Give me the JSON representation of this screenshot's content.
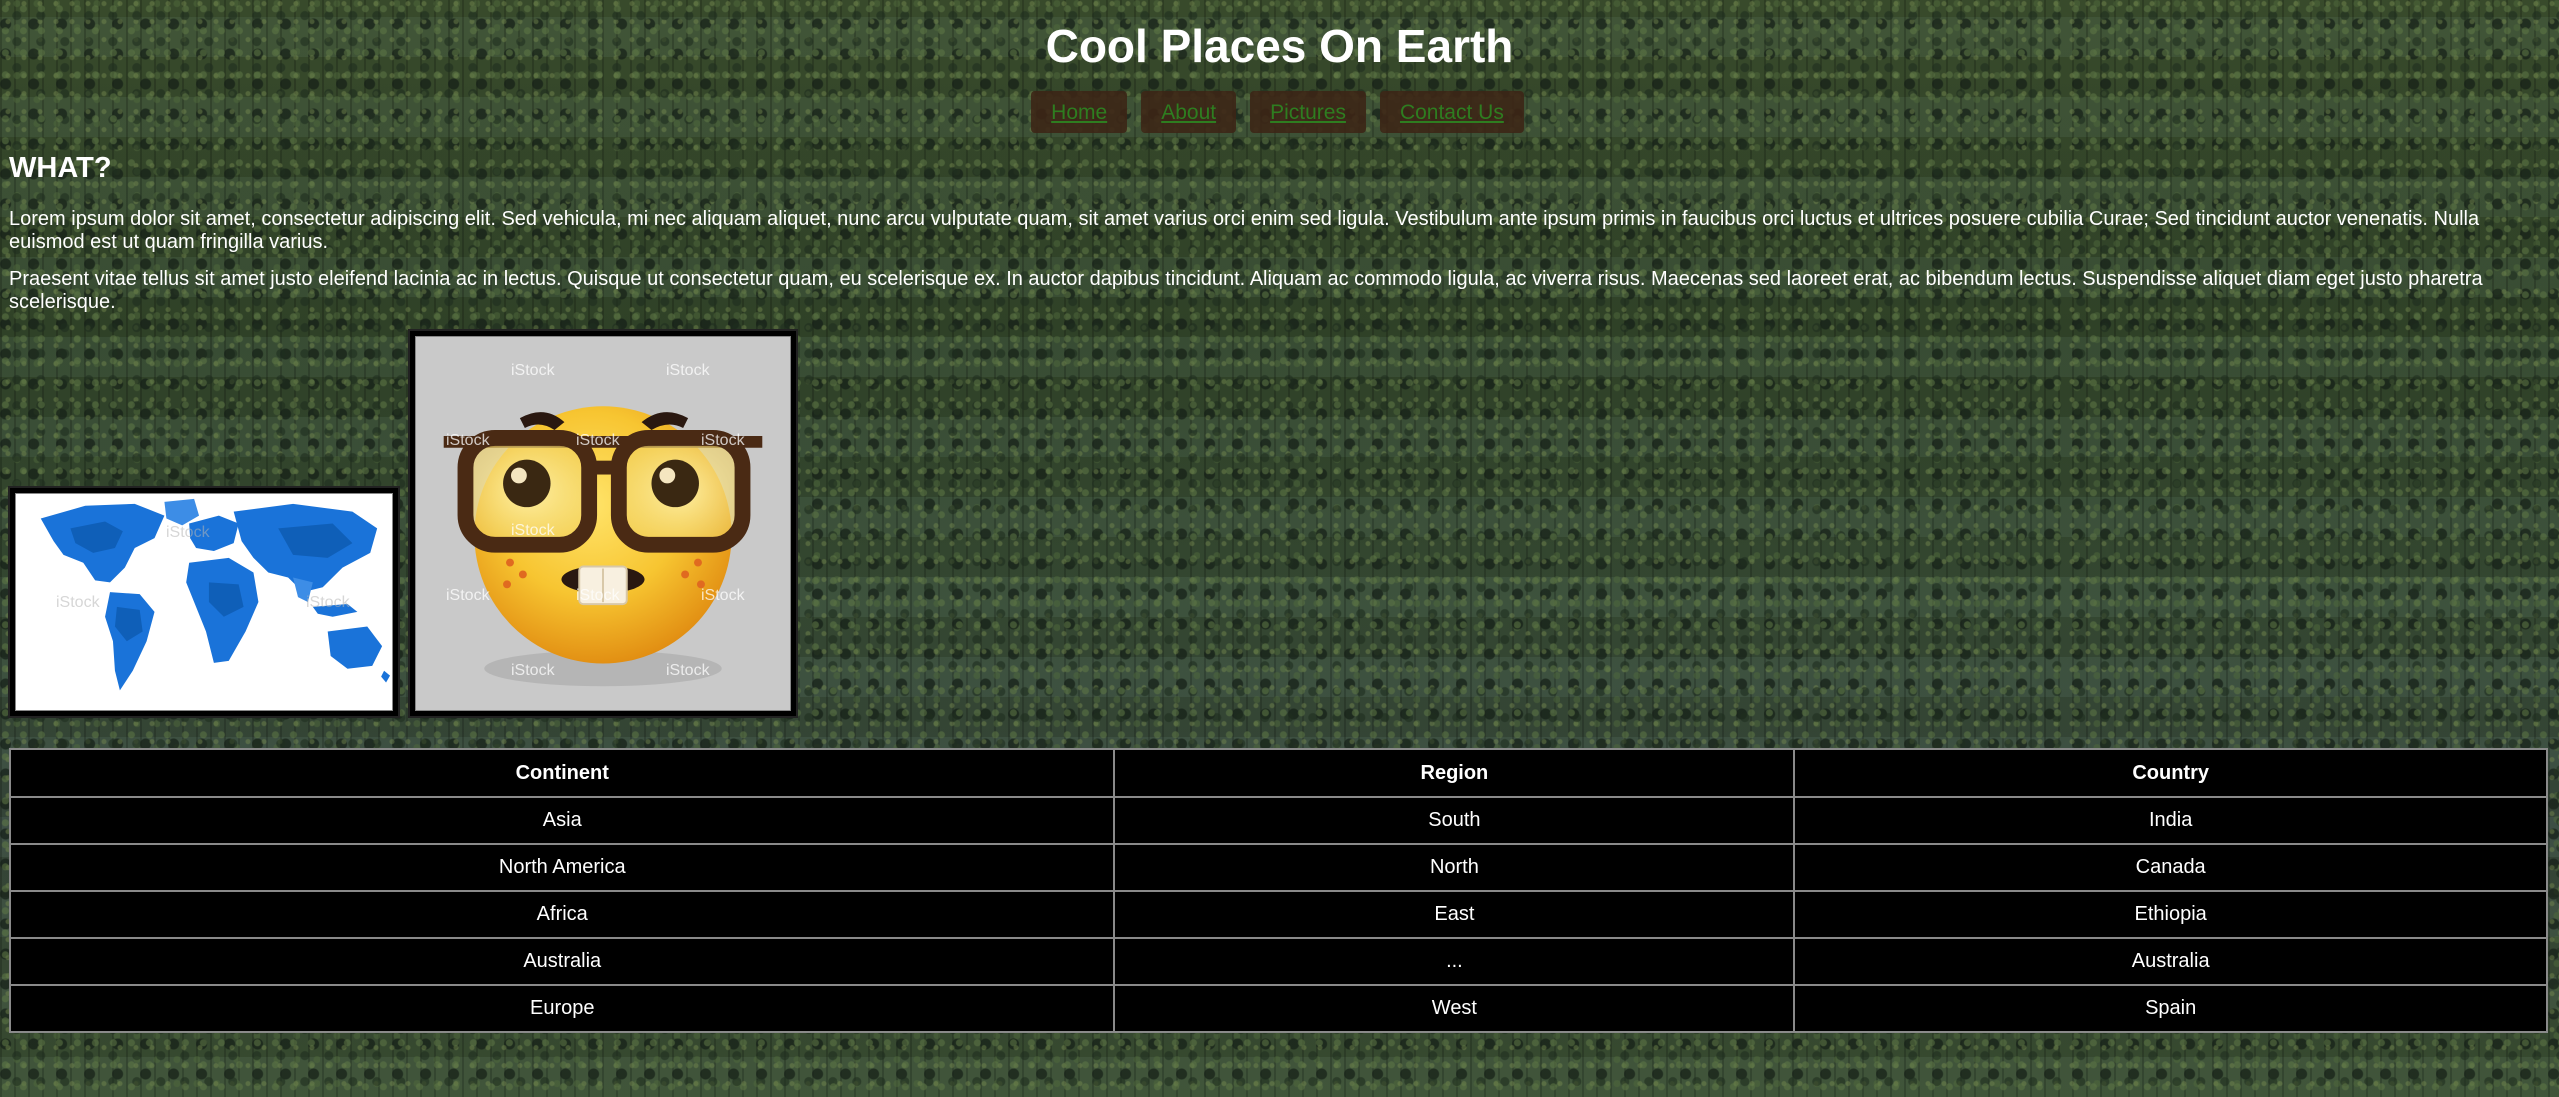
{
  "header": {
    "title": "Cool Places On Earth"
  },
  "nav": {
    "items": [
      {
        "label": "Home"
      },
      {
        "label": "About"
      },
      {
        "label": "Pictures"
      },
      {
        "label": "Contact Us"
      }
    ]
  },
  "content": {
    "heading": "WHAT?",
    "paragraphs": [
      "Lorem ipsum dolor sit amet, consectetur adipiscing elit. Sed vehicula, mi nec aliquam aliquet, nunc arcu vulputate quam, sit amet varius orci enim sed ligula. Vestibulum ante ipsum primis in faucibus orci luctus et ultrices posuere cubilia Curae; Sed tincidunt auctor venenatis. Nulla euismod est ut quam fringilla varius.",
      "Praesent vitae tellus sit amet justo eleifend lacinia ac in lectus. Quisque ut consectetur quam, eu scelerisque ex. In auctor dapibus tincidunt. Aliquam ac commodo ligula, ac viverra risus. Maecenas sed laoreet erat, ac bibendum lectus. Suspendisse aliquet diam eget justo pharetra scelerisque."
    ]
  },
  "images": {
    "map": {
      "watermark": "iStock"
    },
    "emoji": {
      "watermark": "iStock"
    }
  },
  "table": {
    "headers": [
      "Continent",
      "Region",
      "Country"
    ],
    "rows": [
      [
        "Asia",
        "South",
        "India"
      ],
      [
        "North America",
        "North",
        "Canada"
      ],
      [
        "Africa",
        "East",
        "Ethiopia"
      ],
      [
        "Australia",
        "...",
        "Australia"
      ],
      [
        "Europe",
        "West",
        "Spain"
      ]
    ]
  },
  "colors": {
    "nav_background": "#3c2416",
    "nav_link": "#2e7d20",
    "table_background": "#000000",
    "map_land": "#1a73d9",
    "emoji_face": "#f7c531"
  }
}
